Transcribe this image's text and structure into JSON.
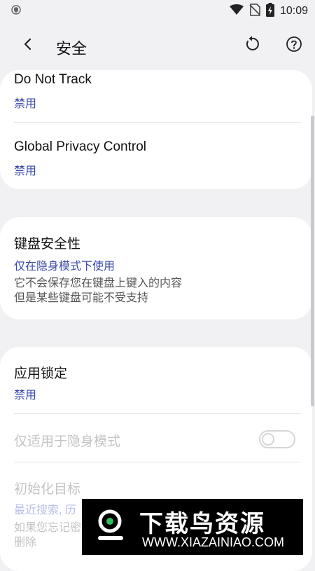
{
  "status": {
    "time": "10:09"
  },
  "appbar": {
    "title": "安全"
  },
  "items": {
    "dnt": {
      "title": "Do Not Track",
      "value": "禁用"
    },
    "gpc": {
      "title": "Global Privacy Control",
      "value": "禁用"
    },
    "keyboard": {
      "title": "键盘安全性",
      "value": "仅在隐身模式下使用",
      "desc1": "它不会保存您在键盘上键入的内容",
      "desc2": "但是某些键盘可能不受支持"
    },
    "applock": {
      "title": "应用锁定",
      "value": "禁用"
    },
    "incognito_only": {
      "title": "仅适用于隐身模式",
      "toggle_on": false
    },
    "reset_target": {
      "title": "初始化目标",
      "value": "最近搜索, 历",
      "desc1": "如果您忘记密",
      "desc2": "删除"
    }
  },
  "watermark": {
    "title": "下载鸟资源",
    "url": "WWW.XIAZAINIAO.COM"
  },
  "icons": {
    "status_left": "shield-icon",
    "wifi": "wifi-icon",
    "no_sim": "no-sim-icon",
    "battery": "battery-charging-icon",
    "back": "back-arrow-icon",
    "reset": "reset-icon",
    "help": "help-icon"
  }
}
